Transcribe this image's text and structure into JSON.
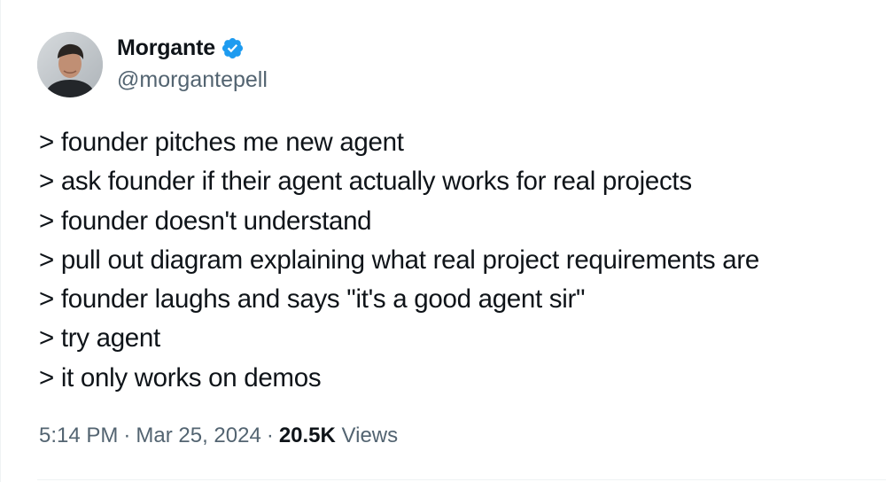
{
  "tweet": {
    "author": {
      "display_name": "Morgante",
      "handle": "@morgantepell",
      "verified": true,
      "avatar_icon": "profile-photo"
    },
    "lines": [
      "> founder pitches me new agent",
      "> ask founder if their agent actually works for real projects",
      "> founder doesn't understand",
      "> pull out diagram explaining what real project requirements are",
      "> founder laughs and says \"it's a good agent sir\"",
      "> try agent",
      "> it only works on demos"
    ],
    "time": "5:14 PM",
    "date": "Mar 25, 2024",
    "separator": "·",
    "views_count": "20.5K",
    "views_label": "Views"
  },
  "colors": {
    "text_primary": "#0f1419",
    "text_secondary": "#536471",
    "verified_blue": "#1d9bf0",
    "divider": "#eff3f4"
  }
}
